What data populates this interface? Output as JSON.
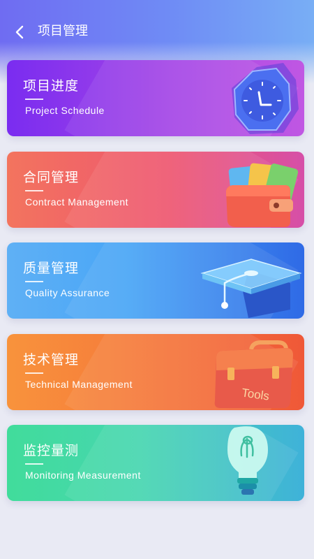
{
  "header": {
    "title": "项目管理"
  },
  "cards": [
    {
      "title": "项目进度",
      "subtitle": "Project Schedule",
      "icon": "clock-icon"
    },
    {
      "title": "合同管理",
      "subtitle": "Contract Management",
      "icon": "wallet-icon"
    },
    {
      "title": "质量管理",
      "subtitle": "Quality Assurance",
      "icon": "graduation-cap-icon"
    },
    {
      "title": "技术管理",
      "subtitle": "Technical Management",
      "icon": "toolbox-icon",
      "icon_text": "Tools"
    },
    {
      "title": "监控量测",
      "subtitle": "Monitoring  Measurement",
      "icon": "lightbulb-icon"
    }
  ],
  "colors": {
    "header_start": "#6f6cf2",
    "header_end": "#78aef5",
    "background": "#e9eaf4"
  }
}
